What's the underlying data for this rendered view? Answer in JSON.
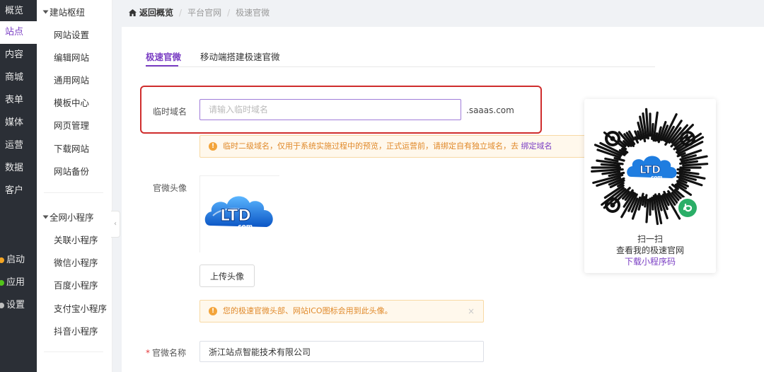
{
  "sidebar": {
    "items": [
      {
        "label": "概览"
      },
      {
        "label": "站点"
      },
      {
        "label": "内容"
      },
      {
        "label": "商城"
      },
      {
        "label": "表单"
      },
      {
        "label": "媒体"
      },
      {
        "label": "运营"
      },
      {
        "label": "数据"
      },
      {
        "label": "客户"
      }
    ],
    "bottom": [
      {
        "label": "启动",
        "color": "#f5a623"
      },
      {
        "label": "应用",
        "color": "#52c41a"
      },
      {
        "label": "设置",
        "color": "#bfbfbf"
      }
    ]
  },
  "subnav": {
    "group1": {
      "title": "建站枢纽",
      "items": [
        "网站设置",
        "编辑网站",
        "通用网站",
        "模板中心",
        "网页管理",
        "下载网站",
        "网站备份"
      ]
    },
    "group2": {
      "title": "全网小程序",
      "items": [
        "关联小程序",
        "微信小程序",
        "百度小程序",
        "支付宝小程序",
        "抖音小程序"
      ]
    }
  },
  "breadcrumb": {
    "home": "返回概览",
    "crumbs": [
      "平台官网",
      "极速官微"
    ]
  },
  "tabs": [
    "极速官微",
    "移动端搭建极速官微"
  ],
  "form": {
    "domain_label": "临时域名",
    "domain_placeholder": "请输入临时域名",
    "domain_suffix": ".saaas.com",
    "domain_alert": "临时二级域名，仅用于系统实施过程中的预览，正式运营前，请绑定自有独立域名，去",
    "domain_alert_link": "绑定域名",
    "avatar_label": "官微头像",
    "avatar_logo_text": "LTD",
    "avatar_logo_sub": ".com",
    "upload_button": "上传头像",
    "avatar_alert": "您的极速官微头部、网站ICO图标会用到此头像。",
    "alert_close": "×",
    "name_label": "官微名称",
    "name_required": "*",
    "name_value": "浙江站点智能技术有限公司"
  },
  "qr": {
    "logo_text": "LTD",
    "logo_sub": ".com",
    "line1": "扫一扫",
    "line2": "查看我的极速官网",
    "link": "下载小程序码"
  },
  "colors": {
    "accent": "#7b3fc4",
    "sidebar_bg": "#2b2f36",
    "alert_bg": "#fff8ec",
    "alert_text": "#e0892a",
    "highlight": "#cf2d2d"
  }
}
